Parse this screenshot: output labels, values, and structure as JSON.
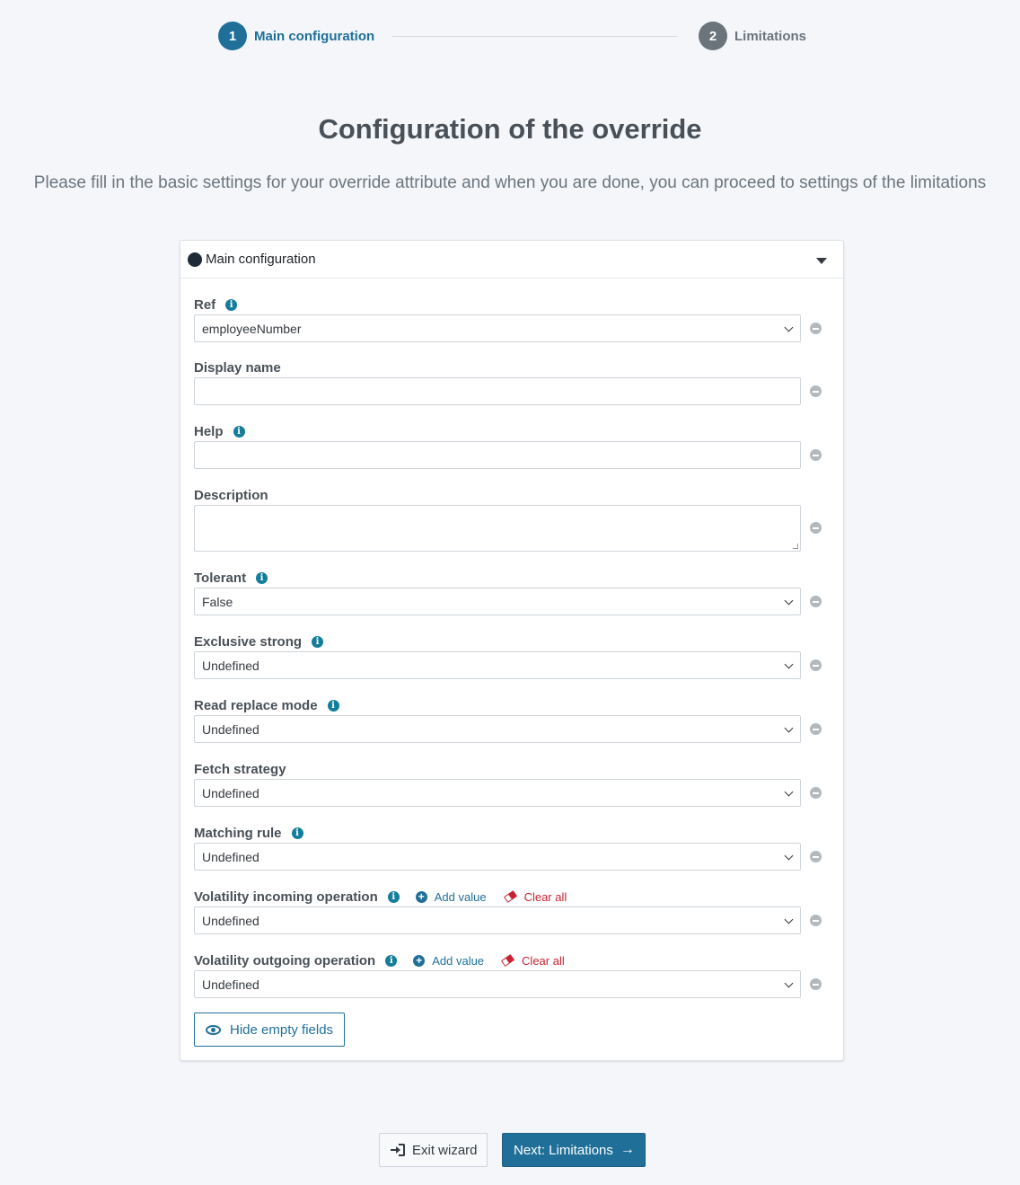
{
  "wizard": {
    "steps": [
      {
        "number": "1",
        "label": "Main configuration"
      },
      {
        "number": "2",
        "label": "Limitations"
      }
    ]
  },
  "page": {
    "title": "Configuration of the override",
    "subtitle": "Please fill in the basic settings for your override attribute and when you are done, you can proceed to settings of the limitations"
  },
  "panel": {
    "title": "Main configuration",
    "fields": {
      "ref": {
        "label": "Ref",
        "value": "employeeNumber"
      },
      "display_name": {
        "label": "Display name",
        "value": ""
      },
      "help": {
        "label": "Help",
        "value": ""
      },
      "description": {
        "label": "Description",
        "value": ""
      },
      "tolerant": {
        "label": "Tolerant",
        "value": "False"
      },
      "exclusive_strong": {
        "label": "Exclusive strong",
        "value": "Undefined"
      },
      "read_replace_mode": {
        "label": "Read replace mode",
        "value": "Undefined"
      },
      "fetch_strategy": {
        "label": "Fetch strategy",
        "value": "Undefined"
      },
      "matching_rule": {
        "label": "Matching rule",
        "value": "Undefined"
      },
      "volatility_incoming": {
        "label": "Volatility incoming operation",
        "value": "Undefined"
      },
      "volatility_outgoing": {
        "label": "Volatility outgoing operation",
        "value": "Undefined"
      }
    },
    "add_value_label": "Add value",
    "clear_all_label": "Clear all",
    "hide_empty_label": "Hide empty fields"
  },
  "footer": {
    "exit_label": "Exit wizard",
    "next_label": "Next: Limitations"
  },
  "colors": {
    "primary": "#1f6f99",
    "info": "#137d9c",
    "danger": "#c82333",
    "muted": "#6b737b"
  }
}
